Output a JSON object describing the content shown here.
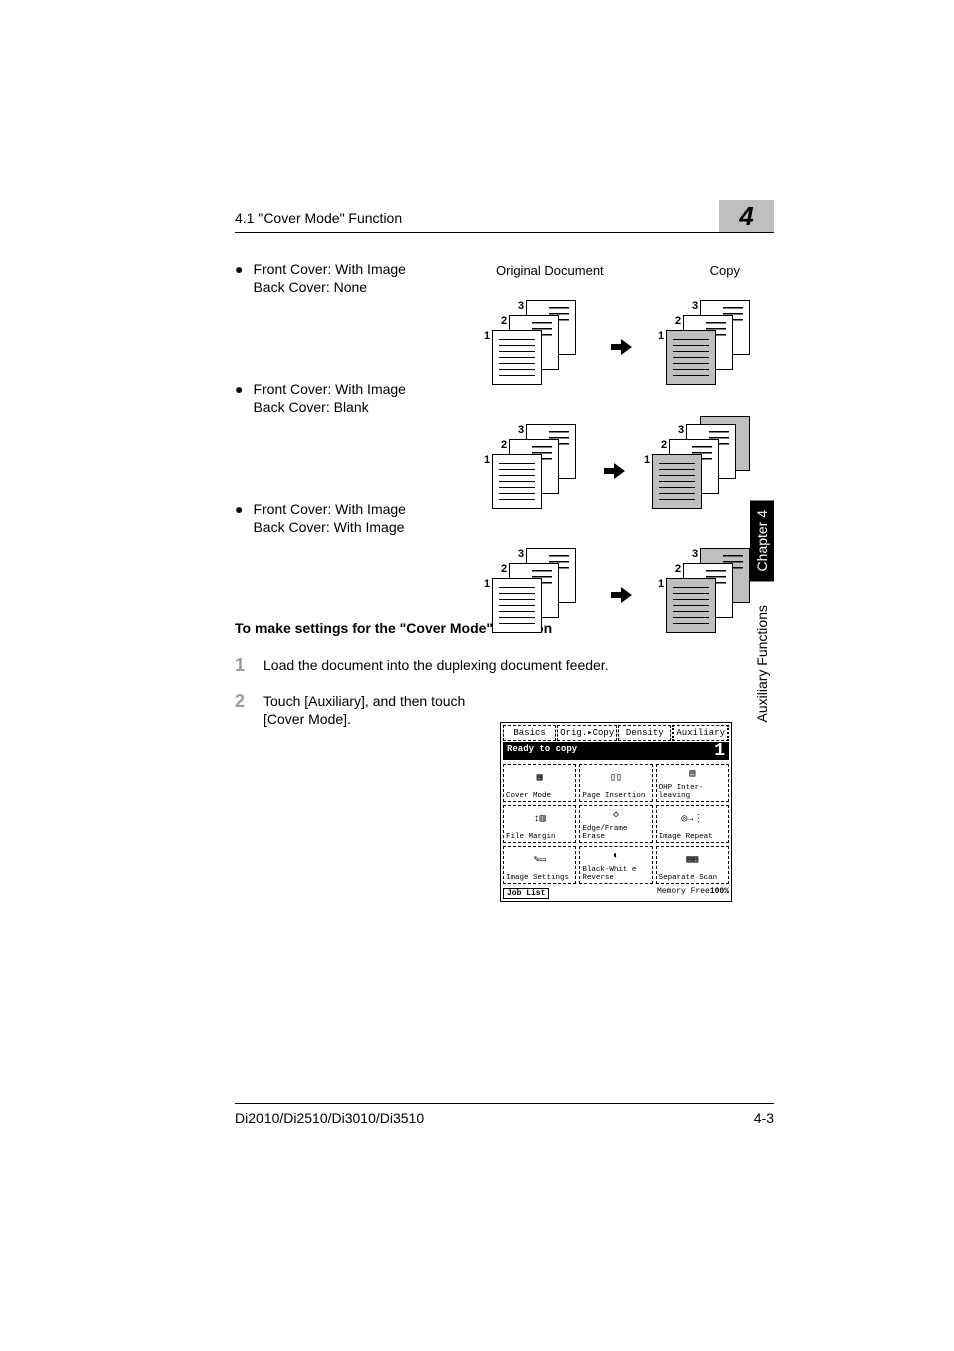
{
  "header": {
    "running_head": "4.1 \"Cover Mode\" Function",
    "chapter_number": "4"
  },
  "side_tabs": {
    "chapter": "Chapter 4",
    "section": "Auxiliary Functions"
  },
  "bullets": [
    {
      "line1": "Front Cover: With Image",
      "line2": "Back Cover: None"
    },
    {
      "line1": "Front Cover: With Image",
      "line2": "Back Cover: Blank"
    },
    {
      "line1": "Front Cover: With Image",
      "line2": "Back Cover: With Image"
    }
  ],
  "fig_headers": {
    "left": "Original Document",
    "right": "Copy"
  },
  "fig_labels": {
    "n1": "1",
    "n2": "2",
    "n3": "3"
  },
  "procedure": {
    "heading": "To make settings for the \"Cover Mode\" function",
    "steps": [
      {
        "num": "1",
        "text": "Load the document into the duplexing document feeder."
      },
      {
        "num": "2",
        "text": "Touch [Auxiliary], and then touch [Cover Mode]."
      }
    ]
  },
  "ui": {
    "tabs": [
      "Basics",
      "Orig.▸Copy",
      "Density",
      "Auxiliary"
    ],
    "status": "Ready to copy",
    "copies": "1",
    "buttons": [
      "Cover Mode",
      "Page Insertion",
      "OHP Inter-leaving",
      "File Margin",
      "Edge/Frame Erase",
      "Image Repeat",
      "Image Settings",
      "Black-Whit e Reverse",
      "Separate Scan"
    ],
    "job_list": "Job List",
    "mem_label": "Memory Free",
    "mem_value": "100%"
  },
  "footer": {
    "left": "Di2010/Di2510/Di3010/Di3510",
    "right": "4-3"
  }
}
